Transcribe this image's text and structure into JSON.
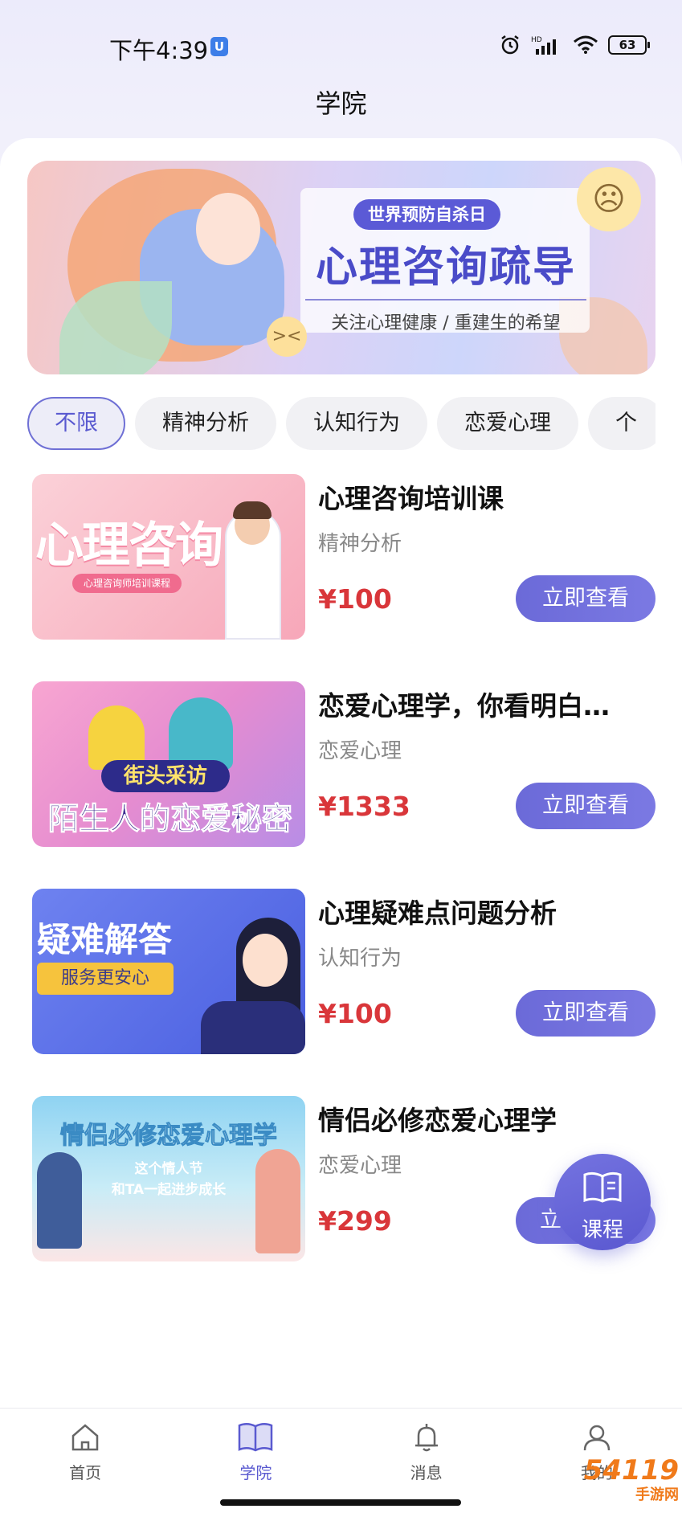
{
  "status_bar": {
    "time": "下午4:39",
    "badge": "U",
    "battery": "63"
  },
  "header": {
    "title": "学院"
  },
  "banner": {
    "tag": "世界预防自杀日",
    "title": "心理咨询疏导",
    "subtitle": "关注心理健康 / 重建生的希望"
  },
  "filters": [
    {
      "label": "不限",
      "active": true
    },
    {
      "label": "精神分析"
    },
    {
      "label": "认知行为"
    },
    {
      "label": "恋爱心理"
    },
    {
      "label": "个"
    }
  ],
  "courses": [
    {
      "title": "心理咨询培训课",
      "category": "精神分析",
      "price": "¥100",
      "button": "立即查看",
      "thumb": {
        "text": "心理咨询",
        "pill": "心理咨询师培训课程"
      }
    },
    {
      "title": "恋爱心理学，你看明白…",
      "category": "恋爱心理",
      "price": "¥1333",
      "button": "立即查看",
      "thumb": {
        "text1": "街头采访",
        "text2": "陌生人的恋爱秘密"
      }
    },
    {
      "title": "心理疑难点问题分析",
      "category": "认知行为",
      "price": "¥100",
      "button": "立即查看",
      "thumb": {
        "text1": "疑难解答",
        "text2": "服务更安心"
      }
    },
    {
      "title": "情侣必修恋爱心理学",
      "category": "恋爱心理",
      "price": "¥299",
      "button": "立",
      "thumb": {
        "text1": "情侣必修恋爱心理学",
        "line1": "这个情人节",
        "line2": "和TA一起进步成长"
      }
    }
  ],
  "float_button": {
    "label": "课程",
    "icon": "book-icon"
  },
  "tab_bar": [
    {
      "label": "首页",
      "icon": "home-icon"
    },
    {
      "label": "学院",
      "icon": "book-icon",
      "active": true
    },
    {
      "label": "消息",
      "icon": "bell-icon"
    },
    {
      "label": "我的",
      "icon": "user-icon"
    }
  ],
  "watermark": {
    "text": "54119",
    "sub": "手游网"
  },
  "colors": {
    "accent": "#6b6ad8",
    "price": "#d9363a",
    "banner_title": "#4a4bc8"
  }
}
